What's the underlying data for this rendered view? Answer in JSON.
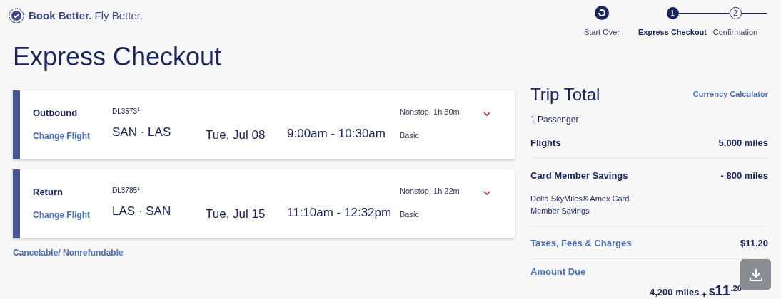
{
  "brand": {
    "tagline_bold": "Book Better.",
    "tagline": "Fly Better."
  },
  "start_over": {
    "label": "Start Over"
  },
  "steps": [
    {
      "number": "1",
      "label": "Express Checkout",
      "selected": true
    },
    {
      "number": "2",
      "label": "Confirmation",
      "selected": false
    }
  ],
  "page_title": "Express Checkout",
  "flights": [
    {
      "direction": "Outbound",
      "change_link": "Change Flight",
      "flight_number": "DL3573$^{1}$",
      "origin": "SAN",
      "separator": "·",
      "destination": "LAS",
      "date": "Tue, Jul 08",
      "time": "9:00am - 10:30am",
      "stops": "Nonstop, 1h 30m",
      "fare": "Basic"
    },
    {
      "direction": "Return",
      "change_link": "Change Flight",
      "flight_number": "DL3785$^{1}$",
      "origin": "LAS",
      "separator": "·",
      "destination": "SAN",
      "date": "Tue, Jul 15",
      "time": "11:10am - 12:32pm",
      "stops": "Nonstop, 1h 22m",
      "fare": "Basic"
    }
  ],
  "fare_rules_link": "Cancelable/ Nonrefundable",
  "trip_total": {
    "title": "Trip Total",
    "currency_link": "Currency Calculator",
    "passengers": "1 Passenger",
    "lines": [
      {
        "kind": "plain",
        "label": "Flights",
        "value": "5,000 miles"
      },
      {
        "kind": "plain",
        "label": "Card Member Savings",
        "value": "- 800 miles",
        "note": "Delta SkyMiles® Amex Card Member Savings"
      },
      {
        "kind": "link",
        "label": "Taxes, Fees & Charges",
        "value": "$11.20"
      }
    ],
    "amount_due": {
      "label": "Amount Due",
      "miles": "4,200 miles",
      "plus": "+",
      "currency": "$",
      "whole": "11",
      "cents": ".20"
    }
  }
}
